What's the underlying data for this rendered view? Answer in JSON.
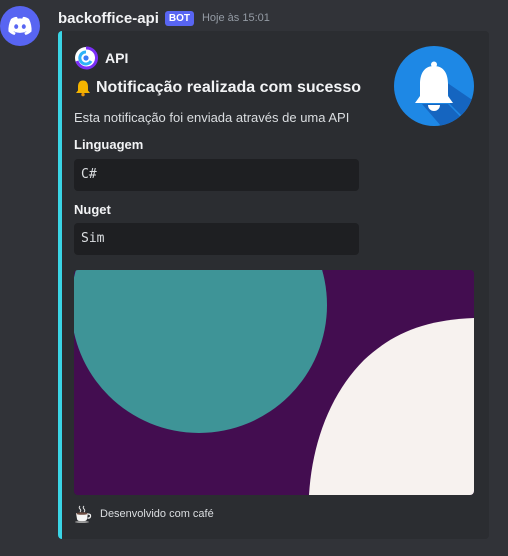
{
  "message": {
    "username": "backoffice-api",
    "badge": "BOT",
    "timestamp": "Hoje às 15:01",
    "avatar_icon": "discord-logo-icon"
  },
  "embed": {
    "accent_color": "#3ad5e6",
    "author": {
      "name": "API",
      "icon": "api-logo-icon"
    },
    "title": "Notificação realizada com sucesso",
    "title_icon": "bell-emoji-icon",
    "description": "Esta notificação foi enviada através de uma API",
    "fields": [
      {
        "name": "Linguagem",
        "value": "C#"
      },
      {
        "name": "Nuget",
        "value": "Sim"
      }
    ],
    "thumbnail_icon": "bell-icon",
    "image": {
      "colors": [
        "#430d50",
        "#3e9497",
        "#f7f2ef"
      ]
    },
    "footer": {
      "text": "Desenvolvido com café",
      "icon": "coffee-icon"
    }
  }
}
